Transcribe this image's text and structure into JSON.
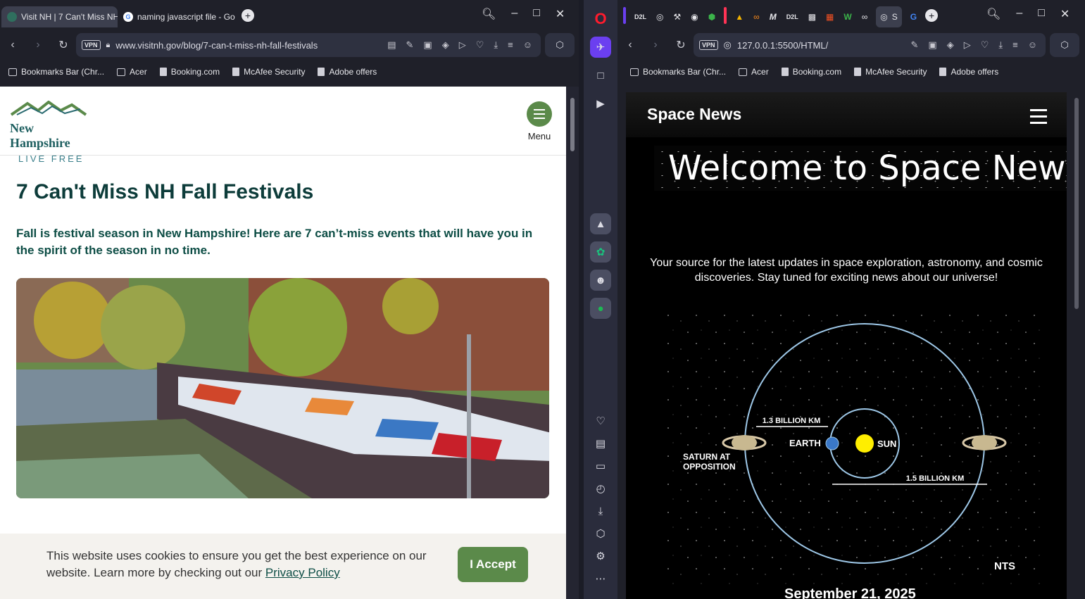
{
  "left_browser": {
    "tabs": [
      {
        "title": "Visit NH | 7 Can't Miss NH",
        "active": true
      },
      {
        "title": "naming javascript file - Go",
        "active": false
      }
    ],
    "url": "www.visitnh.gov/blog/7-can-t-miss-nh-fall-festivals",
    "vpn_label": "VPN",
    "bookmarks": [
      "Bookmarks Bar (Chr...",
      "Acer",
      "Booking.com",
      "McAfee Security",
      "Adobe offers"
    ]
  },
  "nh_page": {
    "logo_brand": "New Hampshire",
    "logo_tagline": "LIVE FREE",
    "menu_label": "Menu",
    "title": "7 Can't Miss NH Fall Festivals",
    "lede": "Fall is festival season in New Hampshire! Here are 7 can’t-miss events that will have you in the spirit of the season in no time.",
    "cookie_text": "This website uses cookies to ensure you get the best experience on our website. Learn more by checking out our",
    "cookie_link": "Privacy Policy",
    "accept_label": "I Accept",
    "accent_color": "#5b8a4a"
  },
  "right_browser": {
    "tab_labels": [
      "D2L",
      "M",
      "D2L",
      "W",
      "S"
    ],
    "url": "127.0.0.1:5500/HTML/",
    "vpn_label": "VPN",
    "bookmarks": [
      "Bookmarks Bar (Chr...",
      "Acer",
      "Booking.com",
      "McAfee Security",
      "Adobe offers"
    ]
  },
  "space_page": {
    "brand": "Space News",
    "welcome": "Welcome to Space News",
    "intro": "Your source for the latest updates in space exploration, astronomy, and cosmic discoveries. Stay tuned for exciting news about our universe!",
    "diagram": {
      "label_saturn": "SATURN AT",
      "label_saturn2": "OPPOSITION",
      "label_earth": "EARTH",
      "label_sun": "SUN",
      "dist1": "1.3 BILLION KM",
      "dist2": "1.5 BILLION KM",
      "nts": "NTS"
    },
    "date": "September 21, 2025"
  },
  "icons": [
    "search-icon",
    "minimize-icon",
    "maximize-icon",
    "close-icon",
    "back-icon",
    "forward-icon",
    "reload-icon",
    "lock-icon",
    "menu-icon"
  ]
}
